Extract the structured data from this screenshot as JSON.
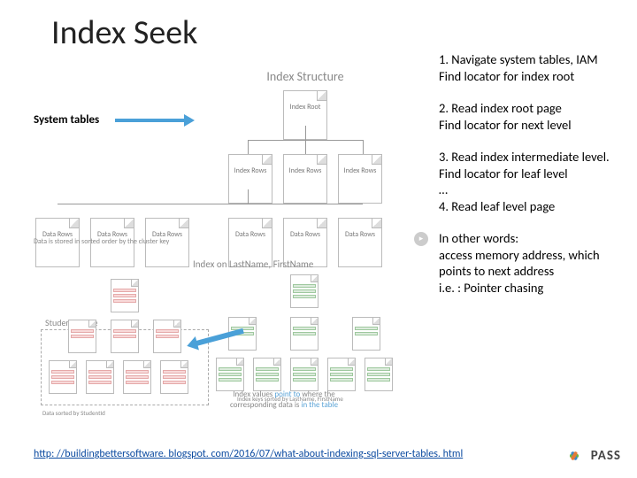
{
  "title": "Index Seek",
  "system_label": "System tables",
  "diagram_top": {
    "title": "Index Structure",
    "root_label": "Index\nRoot",
    "mid_label": "Index\nRows",
    "leaf_label": "Data\nRows",
    "caption": "Data is stored in sorted order by the cluster key"
  },
  "diagram_bottom": {
    "title": "Index on LastName, FirstName",
    "students_label": "Students Table",
    "caption_left": "Data sorted by StudentId",
    "caption_right": "Index keys sorted by LastName, FirstName",
    "bottom_text_a": "Index values",
    "bottom_text_b": "point to",
    "bottom_text_c": "where the",
    "bottom_text_d": "corresponding data is",
    "bottom_text_e": "in the table"
  },
  "steps": {
    "s1a": "1. Navigate system tables, IAM",
    "s1b": "Find locator for index root",
    "s2a": "2. Read index root page",
    "s2b": "Find locator for next level",
    "s3a": "3. Read index intermediate level. Find locator for leaf level",
    "s3b": "…",
    "s3c": "4. Read leaf level page",
    "s4a": "In other words:",
    "s4b": "access memory address, which points to next address",
    "s4c": " i.e. : Pointer chasing"
  },
  "url": "http: //buildingbettersoftware. blogspot. com/2016/07/what-about-indexing-sql-server-tables. html",
  "logo_text": "PASS"
}
